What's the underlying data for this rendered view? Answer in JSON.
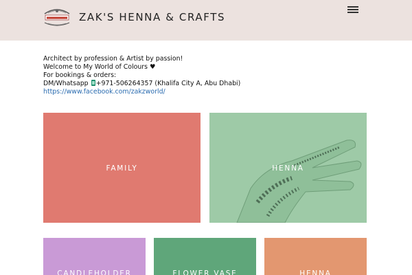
{
  "header": {
    "logo_text": "ZakzWorld",
    "site_title": "ZAK'S HENNA & CRAFTS",
    "menu_icon": "hamburger-icon"
  },
  "intro": {
    "line1": "Architect by profession & Artist by passion!",
    "line2": "Welcome to My World of Colours ♥",
    "line3": "For bookings & orders:",
    "line4_prefix": "DM/Whatsapp ",
    "line4_phone": "+971-506264357 (Khalifa City A, Abu Dhabi)",
    "facebook_link": "https://www.facebook.com/zakzworld/"
  },
  "tiles": [
    {
      "label": "FAMILY",
      "color": "#e07a70"
    },
    {
      "label": "HENNA",
      "color": "#9ecaa7"
    },
    {
      "label": "CANDLEHOLDER",
      "color": "#c99ad6"
    },
    {
      "label": "FLOWER VASE",
      "color": "#5fa67a"
    },
    {
      "label": "HENNA",
      "color": "#e39770"
    }
  ]
}
